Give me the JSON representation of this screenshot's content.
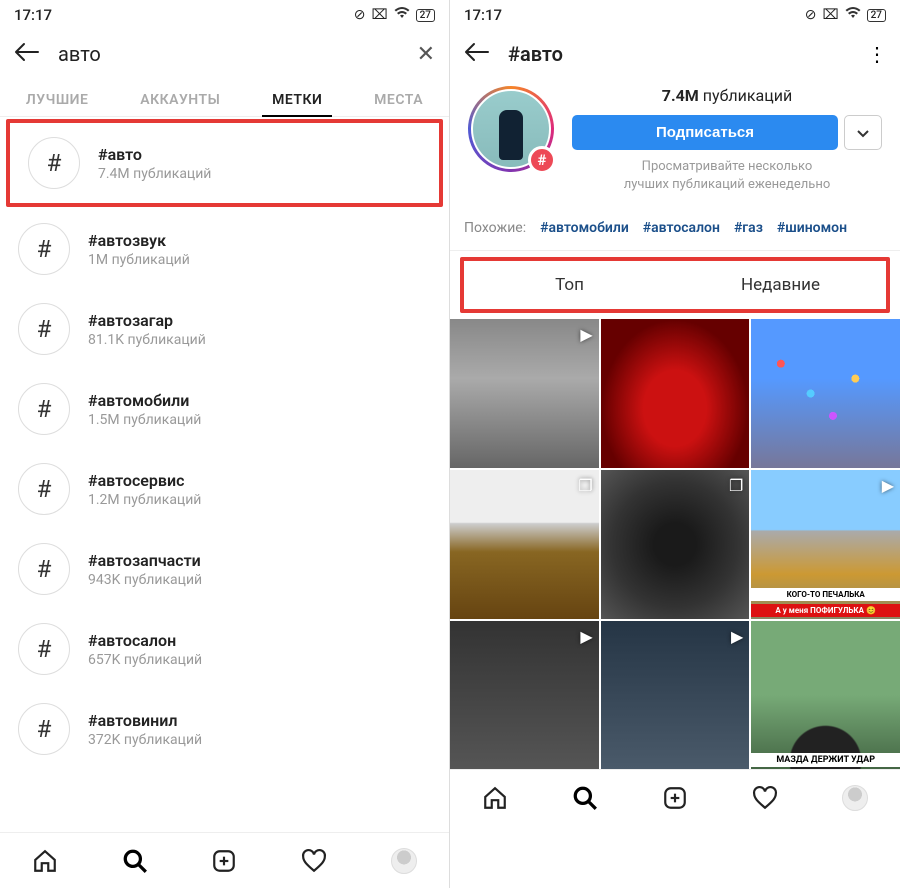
{
  "status": {
    "time": "17:17",
    "battery": "27"
  },
  "left": {
    "search_query": "авто",
    "tabs": [
      "ЛУЧШИЕ",
      "АККАУНТЫ",
      "МЕТКИ",
      "МЕСТА"
    ],
    "active_tab_index": 2,
    "results": [
      {
        "tag": "#авто",
        "count": "7.4M публикаций"
      },
      {
        "tag": "#автозвук",
        "count": "1M публикаций"
      },
      {
        "tag": "#автозагар",
        "count": "81.1K публикаций"
      },
      {
        "tag": "#автомобили",
        "count": "1.5M публикаций"
      },
      {
        "tag": "#автосервис",
        "count": "1.2M публикаций"
      },
      {
        "tag": "#автозапчасти",
        "count": "943K публикаций"
      },
      {
        "tag": "#автосалон",
        "count": "657K публикаций"
      },
      {
        "tag": "#автовинил",
        "count": "372K публикаций"
      }
    ]
  },
  "right": {
    "title": "#авто",
    "count_num": "7.4M",
    "count_label": "публикаций",
    "follow_label": "Подписаться",
    "sub_line1": "Просматривайте несколько",
    "sub_line2": "лучших публикаций еженедельно",
    "related_label": "Похожие:",
    "related": [
      "#автомобили",
      "#автосалон",
      "#газ",
      "#шиномон"
    ],
    "feed_tabs": [
      "Топ",
      "Недавние"
    ],
    "cells": [
      {
        "video": true
      },
      {},
      {},
      {
        "multi": true
      },
      {
        "multi": true
      },
      {
        "video": true,
        "cap1": "КОГО-ТО ПЕЧАЛЬКА",
        "cap2": "А у меня ПОФИГУЛЬКА 😊"
      },
      {
        "video": true
      },
      {
        "video": true
      },
      {
        "cap_bottom": "МАЗДА ДЕРЖИТ УДАР"
      }
    ]
  },
  "icons": {
    "hash": "#"
  }
}
